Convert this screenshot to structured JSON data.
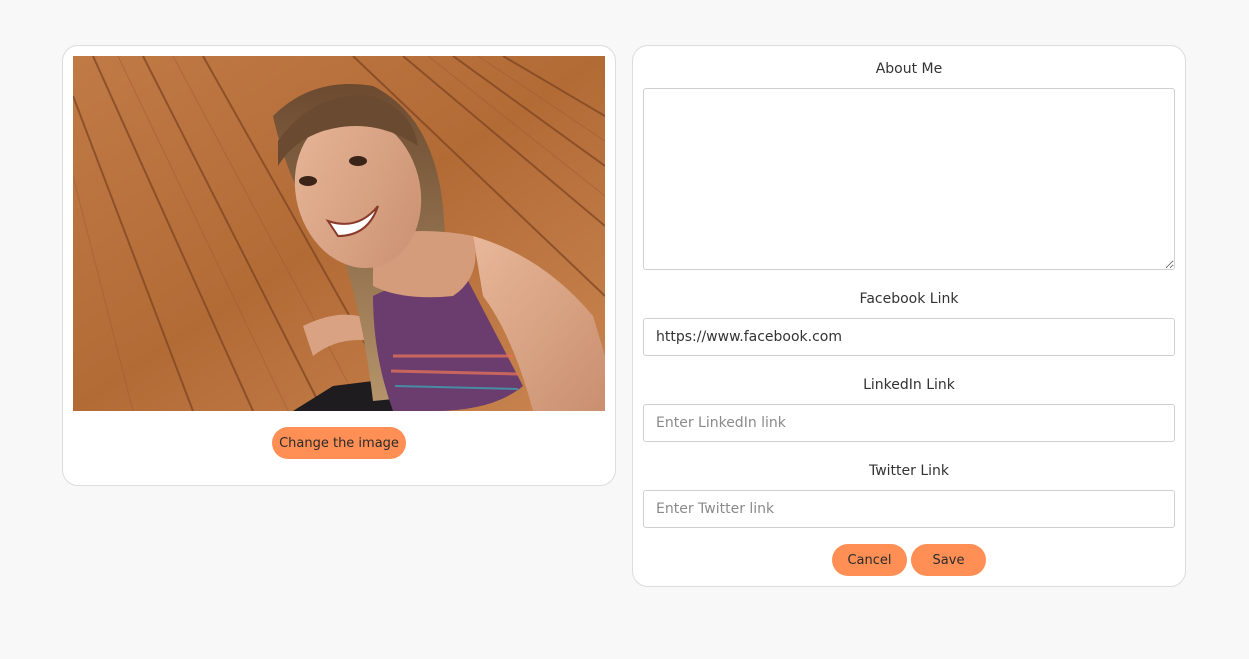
{
  "profile_image": {
    "alt": "",
    "change_button_label": "Change the image"
  },
  "form": {
    "about": {
      "label": "About Me",
      "value": "",
      "placeholder": ""
    },
    "facebook": {
      "label": "Facebook Link",
      "value": "https://www.facebook.com",
      "placeholder": ""
    },
    "linkedin": {
      "label": "LinkedIn Link",
      "value": "",
      "placeholder": "Enter LinkedIn link"
    },
    "twitter": {
      "label": "Twitter Link",
      "value": "",
      "placeholder": "Enter Twitter link"
    },
    "cancel_label": "Cancel",
    "save_label": "Save"
  },
  "colors": {
    "accent": "#ff8f54",
    "background": "#f8f8f8",
    "card": "#ffffff",
    "border": "#dcdcdc"
  }
}
